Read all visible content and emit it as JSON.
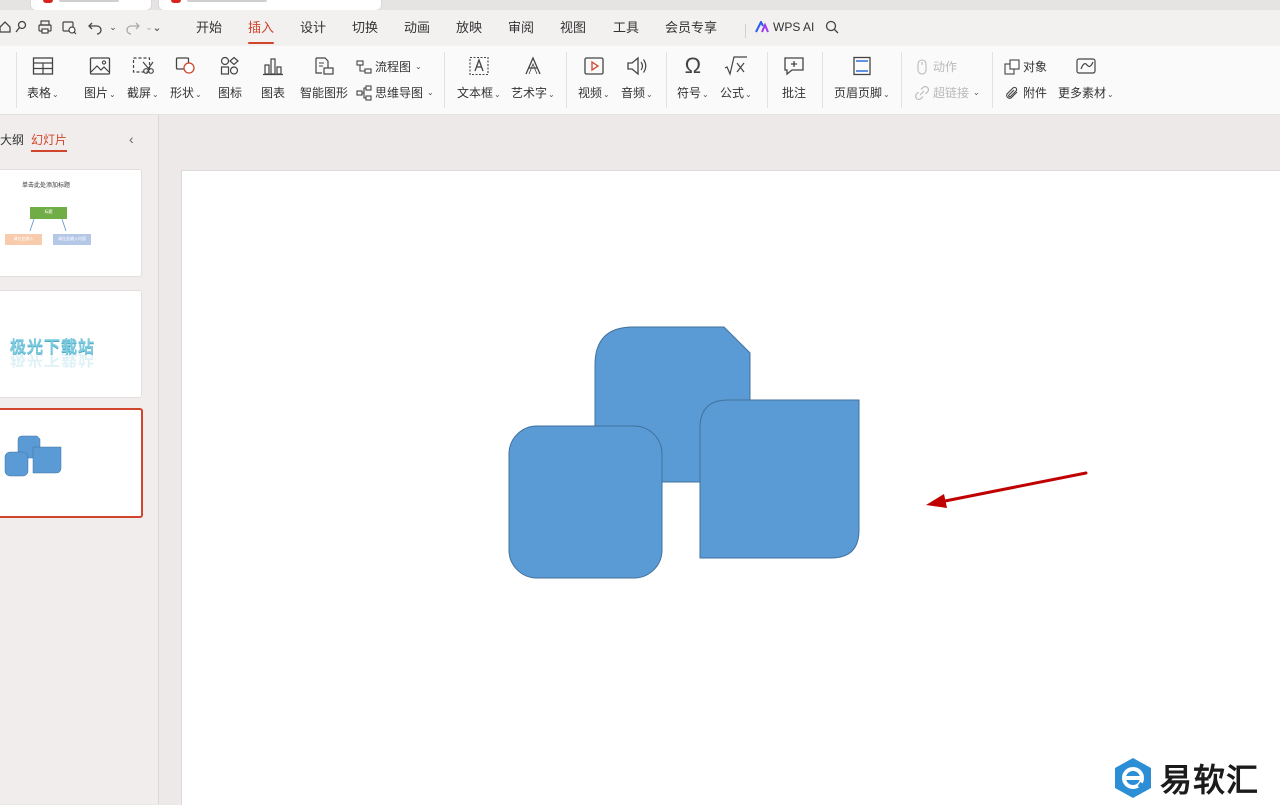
{
  "menubar": {
    "items": [
      "开始",
      "插入",
      "设计",
      "切换",
      "动画",
      "放映",
      "审阅",
      "视图",
      "工具",
      "会员专享"
    ],
    "active": "插入",
    "wps_ai": "WPS AI"
  },
  "ribbon": {
    "table": "表格",
    "picture": "图片",
    "screenshot": "截屏",
    "shape": "形状",
    "icon": "图标",
    "chart": "图表",
    "smartart": "智能图形",
    "flowchart": "流程图",
    "mindmap": "思维导图",
    "textbox": "文本框",
    "wordart": "艺术字",
    "video": "视频",
    "audio": "音频",
    "symbol": "符号",
    "formula": "公式",
    "comment": "批注",
    "header_footer": "页眉页脚",
    "action": "动作",
    "hyperlink": "超链接",
    "object": "对象",
    "attachment": "附件",
    "more_material": "更多素材"
  },
  "left_panel": {
    "tab_outline": "大纲",
    "tab_slides": "幻灯片",
    "active_tab": "幻灯片",
    "slide1": {
      "title": "单击此处添加标题",
      "node_top": "标题",
      "node_left": "请在此输入",
      "node_right": "请在此输入内容"
    },
    "slide2": {
      "text": "极光下载站"
    }
  },
  "watermark": {
    "text": "易软汇"
  },
  "colors": {
    "accent": "#d0452c",
    "shape_fill": "#5b9bd5",
    "shape_stroke": "#41719c",
    "arrow": "#c00000",
    "watermark_blue": "#2c8fd6"
  }
}
